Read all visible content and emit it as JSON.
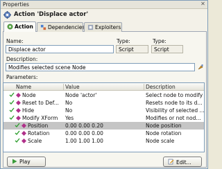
{
  "window": {
    "title": "Properties",
    "close": "✕"
  },
  "header": {
    "title": "Action 'Displace actor'",
    "icon": "gear-icon"
  },
  "tabs": [
    {
      "label": "Action",
      "icon": "gear-icon"
    },
    {
      "label": "Dependencies",
      "icon": "dependencies-icon"
    },
    {
      "label": "Exploiters",
      "icon": "exploiters-icon"
    }
  ],
  "form": {
    "name_label": "Name:",
    "name_value": "Displace actor",
    "type_label": "Type:",
    "type_value": "Script",
    "type2_label": "Type:",
    "type2_value": "Script",
    "description_label": "Description:",
    "description_value": "Modifies selected scene Node",
    "parameters_label": "Parameters:"
  },
  "parameters": {
    "columns": [
      "Name",
      "Value",
      "Description"
    ],
    "rows": [
      {
        "name": "Node",
        "value": "Node 'actor'",
        "description": "Select node to modify",
        "checked": true
      },
      {
        "name": "Reset to Def...",
        "value": "No",
        "description": "Resets node to its d...",
        "checked": true
      },
      {
        "name": "Hide",
        "value": "No",
        "description": "Visibility of selected ...",
        "checked": true
      },
      {
        "name": "Modify XForm",
        "value": "Yes",
        "description": "Modifies or not nod...",
        "checked": true
      },
      {
        "name": "Position",
        "value": "0.00  0.00  0.20",
        "description": "Node position",
        "checked": true,
        "child": true,
        "selected": true
      },
      {
        "name": "Rotation",
        "value": "0.00  0.00  0.00",
        "description": "Node rotation",
        "checked": true,
        "child": true
      },
      {
        "name": "Scale",
        "value": "1.00  1.00  1.00",
        "description": "Node scale",
        "checked": true,
        "child": true
      }
    ]
  },
  "buttons": {
    "play": "Play",
    "edit": "Edit..."
  },
  "colors": {
    "check": "#2e9e2e",
    "diamond": "#b0308a",
    "accent": "#7f9db9"
  }
}
